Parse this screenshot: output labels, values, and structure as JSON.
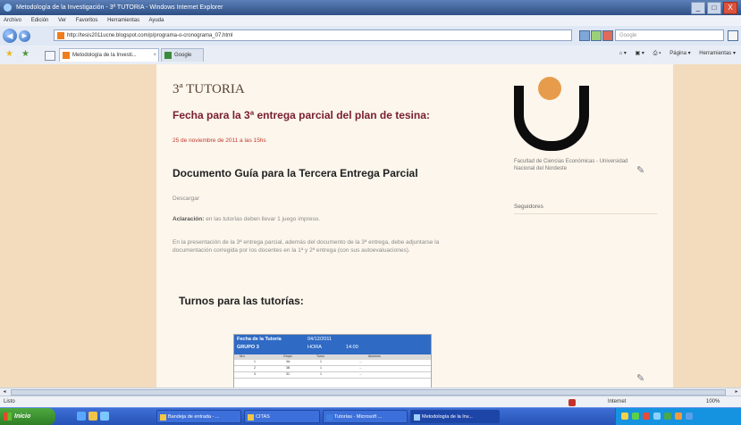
{
  "window": {
    "title": "Metodología de la Investigación - 3ª TUTORIA - Windows Internet Explorer",
    "controls": [
      "_",
      "□",
      "X"
    ]
  },
  "menu": [
    "Archivo",
    "Edición",
    "Ver",
    "Favoritos",
    "Herramientas",
    "Ayuda"
  ],
  "address": {
    "url": "http://tesis2011ucne.blogspot.com/p/programa-o-cronograma_07.html",
    "search_placeholder": "Google"
  },
  "tabs": [
    {
      "label": "Metodología de la Investi...",
      "close": "×"
    },
    {
      "label": "Google",
      "close": ""
    }
  ],
  "commandbar": [
    "Página ▾",
    "Herramientas ▾"
  ],
  "post": {
    "heading": "3ª TUTORIA",
    "subtitle1": "Fecha para la 3ª entrega parcial del plan de tesina:",
    "date_text": "25 de noviembre de 2011 a las 15hs",
    "subtitle2": "Documento Guía para la Tercera Entrega Parcial",
    "download": "Descargar",
    "note_label": "Aclaración:",
    "note_text": " en las tutorías deben llevar 1 juego impreso.",
    "paragraph": "En la presentación de la 3ª entrega parcial, además del documento de la 3ª entrega, debe adjuntarse la documentación corregida por los docentes en la 1ª y 2ª entrega (con sus autoevaluaciones).",
    "subtitle3": "Turnos para las tutorías:"
  },
  "schedule": {
    "title": "Fecha de la Tutoría",
    "date": "04/12/2011",
    "group": "GRUPO 3",
    "hour_label": "HORA",
    "hour": "14:00",
    "columns": [
      "Nro",
      "Grupo",
      "Turno",
      "Alumnos"
    ],
    "rows": [
      [
        "1",
        "3A",
        "1",
        "..."
      ],
      [
        "2",
        "3B",
        "1",
        "..."
      ],
      [
        "3",
        "3C",
        "1",
        "..."
      ]
    ]
  },
  "sidebar": {
    "caption": "Facultad de Ciencias Económicas - Universidad Nacional del Nordeste",
    "followers_title": "Seguidores"
  },
  "status": {
    "left": "Listo",
    "zone": "Internet",
    "zoom": "100%"
  },
  "taskbar": {
    "start": "Inicio",
    "tasks": [
      "Bandeja de entrada - ...",
      "CITAS",
      "Tutorías - Microsoft ...",
      "Metodología de la Inv..."
    ]
  },
  "colors": {
    "heading_red": "#7a2031",
    "date_red": "#c23a2f",
    "page_bg": "#f2dcbd",
    "content_bg": "#fcf6ec",
    "logo_dot": "#e79c4c",
    "table_header": "#2f6ac5"
  }
}
